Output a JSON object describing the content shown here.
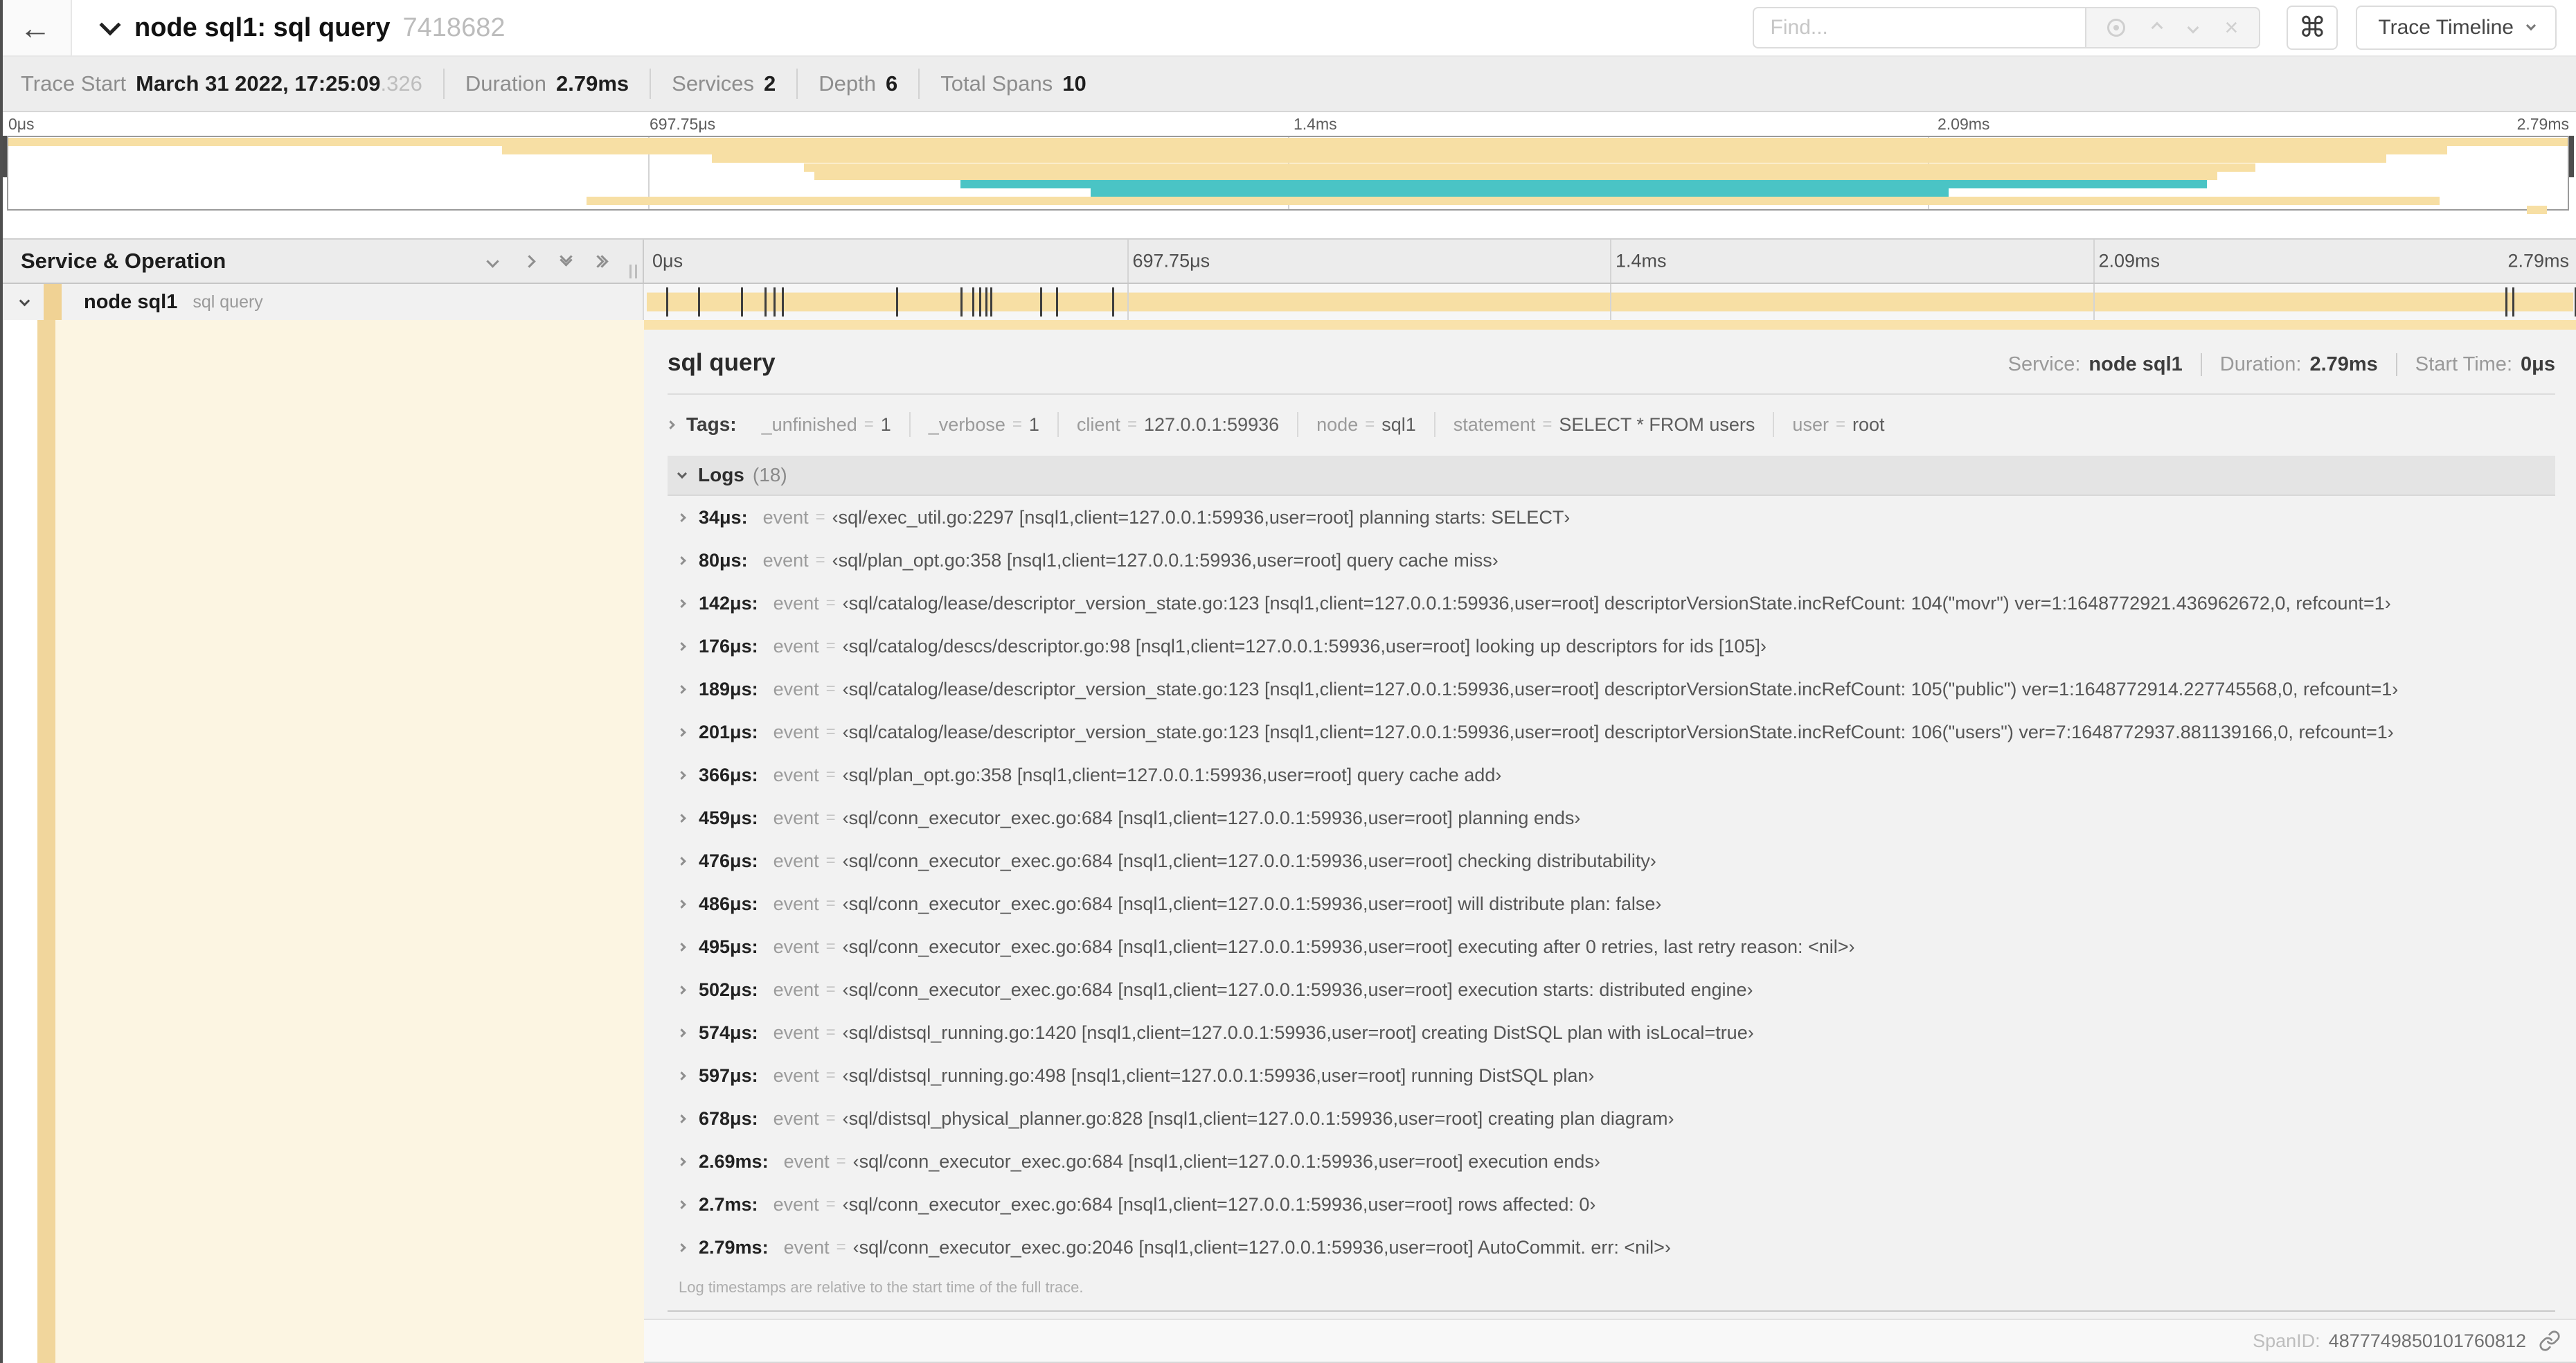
{
  "header": {
    "title": "node sql1: sql query",
    "trace_id_short": "7418682",
    "find_placeholder": "Find...",
    "shortcut_glyph": "⌘",
    "view_selector": "Trace Timeline"
  },
  "icons": {
    "back": "arrow-left",
    "locate": "target",
    "prev-result": "chevron-up",
    "next-result": "chevron-down",
    "clear-search": "x",
    "shortcuts": "command-key",
    "view-dropdown": "chevron-down",
    "collapse-one": "chevron-down",
    "expand-one": "chevron-right",
    "collapse-all": "double-chevron-down",
    "expand-all": "double-chevron-right",
    "span-link": "chain"
  },
  "colors": {
    "span_tan": "#f7dfa4",
    "span_teal": "#4ac4c5",
    "detail_accent": "#f9e2ab",
    "detail_cream": "#fcf5e2",
    "detail_strip": "#f1d69c",
    "log_marker": "#3e3e3e"
  },
  "trace_info": {
    "items": [
      {
        "label": "Trace Start",
        "value": "March 31 2022, 17:25:09",
        "suffix": ".326"
      },
      {
        "label": "Duration",
        "value": "2.79ms",
        "suffix": ""
      },
      {
        "label": "Services",
        "value": "2",
        "suffix": ""
      },
      {
        "label": "Depth",
        "value": "6",
        "suffix": ""
      },
      {
        "label": "Total Spans",
        "value": "10",
        "suffix": ""
      }
    ]
  },
  "timeline": {
    "duration_us": 2790,
    "ticks": [
      "0μs",
      "697.75μs",
      "1.4ms",
      "2.09ms",
      "2.79ms"
    ],
    "tick_percents": [
      0,
      25,
      50,
      75,
      100
    ]
  },
  "minimap": {
    "spans": [
      {
        "start": 0,
        "end": 100,
        "color": "tan"
      },
      {
        "start": 19.3,
        "end": 95.3,
        "color": "tan"
      },
      {
        "start": 27.5,
        "end": 92.9,
        "color": "tan"
      },
      {
        "start": 31.1,
        "end": 87.8,
        "color": "tan"
      },
      {
        "start": 31.5,
        "end": 86.3,
        "color": "tan"
      },
      {
        "start": 37.2,
        "end": 85.9,
        "color": "teal"
      },
      {
        "start": 42.3,
        "end": 75.8,
        "color": "teal"
      },
      {
        "start": 22.6,
        "end": 95.0,
        "color": "tan"
      },
      {
        "start": 98.4,
        "end": 99.2,
        "color": "tan"
      }
    ]
  },
  "span_tree": {
    "header": "Service & Operation",
    "row": {
      "service": "node sql1",
      "operation": "sql query"
    }
  },
  "detail": {
    "title": "sql query",
    "meta": [
      {
        "label": "Service:",
        "value": "node sql1"
      },
      {
        "label": "Duration:",
        "value": "2.79ms"
      },
      {
        "label": "Start Time:",
        "value": "0μs"
      }
    ],
    "tags_label": "Tags:",
    "tags": [
      {
        "key": "_unfinished",
        "value": "1"
      },
      {
        "key": "_verbose",
        "value": "1"
      },
      {
        "key": "client",
        "value": "127.0.0.1:59936"
      },
      {
        "key": "node",
        "value": "sql1"
      },
      {
        "key": "statement",
        "value": "SELECT * FROM users"
      },
      {
        "key": "user",
        "value": "root"
      }
    ],
    "logs_label": "Logs",
    "logs_count": "(18)",
    "log_field_key": "event",
    "logs": [
      {
        "t": "34μs:",
        "us": 34,
        "msg": "‹sql/exec_util.go:2297 [nsql1,client=127.0.0.1:59936,user=root] planning starts: SELECT›"
      },
      {
        "t": "80μs:",
        "us": 80,
        "msg": "‹sql/plan_opt.go:358 [nsql1,client=127.0.0.1:59936,user=root] query cache miss›"
      },
      {
        "t": "142μs:",
        "us": 142,
        "msg": "‹sql/catalog/lease/descriptor_version_state.go:123 [nsql1,client=127.0.0.1:59936,user=root] descriptorVersionState.incRefCount: 104(\"movr\") ver=1:1648772921.436962672,0, refcount=1›"
      },
      {
        "t": "176μs:",
        "us": 176,
        "msg": "‹sql/catalog/descs/descriptor.go:98 [nsql1,client=127.0.0.1:59936,user=root] looking up descriptors for ids [105]›"
      },
      {
        "t": "189μs:",
        "us": 189,
        "msg": "‹sql/catalog/lease/descriptor_version_state.go:123 [nsql1,client=127.0.0.1:59936,user=root] descriptorVersionState.incRefCount: 105(\"public\") ver=1:1648772914.227745568,0, refcount=1›"
      },
      {
        "t": "201μs:",
        "us": 201,
        "msg": "‹sql/catalog/lease/descriptor_version_state.go:123 [nsql1,client=127.0.0.1:59936,user=root] descriptorVersionState.incRefCount: 106(\"users\") ver=7:1648772937.881139166,0, refcount=1›"
      },
      {
        "t": "366μs:",
        "us": 366,
        "msg": "‹sql/plan_opt.go:358 [nsql1,client=127.0.0.1:59936,user=root] query cache add›"
      },
      {
        "t": "459μs:",
        "us": 459,
        "msg": "‹sql/conn_executor_exec.go:684 [nsql1,client=127.0.0.1:59936,user=root] planning ends›"
      },
      {
        "t": "476μs:",
        "us": 476,
        "msg": "‹sql/conn_executor_exec.go:684 [nsql1,client=127.0.0.1:59936,user=root] checking distributability›"
      },
      {
        "t": "486μs:",
        "us": 486,
        "msg": "‹sql/conn_executor_exec.go:684 [nsql1,client=127.0.0.1:59936,user=root] will distribute plan: false›"
      },
      {
        "t": "495μs:",
        "us": 495,
        "msg": "‹sql/conn_executor_exec.go:684 [nsql1,client=127.0.0.1:59936,user=root] executing after 0 retries, last retry reason: <nil>›"
      },
      {
        "t": "502μs:",
        "us": 502,
        "msg": "‹sql/conn_executor_exec.go:684 [nsql1,client=127.0.0.1:59936,user=root] execution starts: distributed engine›"
      },
      {
        "t": "574μs:",
        "us": 574,
        "msg": "‹sql/distsql_running.go:1420 [nsql1,client=127.0.0.1:59936,user=root] creating DistSQL plan with isLocal=true›"
      },
      {
        "t": "597μs:",
        "us": 597,
        "msg": "‹sql/distsql_running.go:498 [nsql1,client=127.0.0.1:59936,user=root] running DistSQL plan›"
      },
      {
        "t": "678μs:",
        "us": 678,
        "msg": "‹sql/distsql_physical_planner.go:828 [nsql1,client=127.0.0.1:59936,user=root] creating plan diagram›"
      },
      {
        "t": "2.69ms:",
        "us": 2690,
        "msg": "‹sql/conn_executor_exec.go:684 [nsql1,client=127.0.0.1:59936,user=root] execution ends›"
      },
      {
        "t": "2.7ms:",
        "us": 2700,
        "msg": "‹sql/conn_executor_exec.go:684 [nsql1,client=127.0.0.1:59936,user=root] rows affected: 0›"
      },
      {
        "t": "2.79ms:",
        "us": 2790,
        "msg": "‹sql/conn_executor_exec.go:2046 [nsql1,client=127.0.0.1:59936,user=root] AutoCommit. err: <nil>›"
      }
    ],
    "logs_note": "Log timestamps are relative to the start time of the full trace.",
    "span_id_label": "SpanID:",
    "span_id": "4877749850101760812"
  }
}
